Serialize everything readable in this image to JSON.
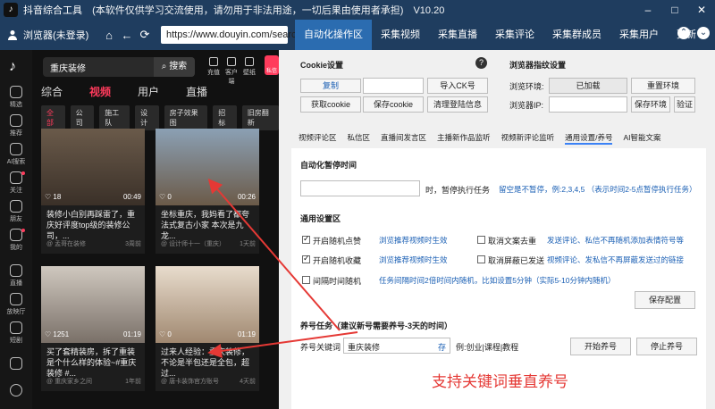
{
  "title_bar": {
    "app_title": "抖音综合工具",
    "notice": "(本软件仅供学习交流使用，请勿用于非法用途，一切后果由使用者承担)",
    "version": "V10.20"
  },
  "toolbar": {
    "browser_label": "浏览器(未登录)",
    "url": "https://www.douyin.com/search/",
    "nav_tabs": [
      "自动化操作区",
      "采集视频",
      "采集直播",
      "采集评论",
      "采集群成员",
      "采集用户",
      "更新"
    ]
  },
  "left": {
    "sidebar": [
      "精选",
      "推荐",
      "AI搜索",
      "关注",
      "朋友",
      "我的",
      "直播",
      "放映厅",
      "短剧"
    ],
    "search_query": "重庆装修",
    "search_button": "搜索",
    "top_icons": [
      "充值",
      "客户端",
      "壁纸",
      "私信"
    ],
    "tabs": [
      "综合",
      "视频",
      "用户",
      "直播"
    ],
    "filters": [
      "全部",
      "公司",
      "施工队",
      "设计",
      "房子效果图",
      "招标",
      "旧房翻新"
    ],
    "cards": [
      {
        "likes": "18",
        "duration": "00:49",
        "title": "装修小白别再踩雷了，重庆好评度top级的装修公司，...",
        "author": "孟哥在装修",
        "ago": "3周前"
      },
      {
        "likes": "0",
        "duration": "00:26",
        "title": "坐标重庆，我妈看了都夸法式复古小家 本次是九龙...",
        "author": "设计师十一（重庆）",
        "ago": "1天前"
      },
      {
        "likes": "1251",
        "duration": "01:19",
        "title": "买了套精装房，拆了重装是个什么样的体验~#重庆装修 #...",
        "author": "重庆家乡之间",
        "ago": "1年前"
      },
      {
        "likes": "0",
        "duration": "01:19",
        "title": "过来人经验：重庆装修，不论是半包还是全包，超过...",
        "author": "唐卡装饰官方账号",
        "ago": "4天前"
      }
    ]
  },
  "right": {
    "cookie_title": "Cookie设置",
    "cookie_copy": "复制",
    "cookie_import": "导入CK号",
    "cookie_get": "获取cookie",
    "cookie_save": "保存cookie",
    "cookie_clear": "清理登陆信息",
    "fingerprint_title": "浏览器指纹设置",
    "env_label": "浏览环境:",
    "env_value": "已加载",
    "env_reset": "重置环境",
    "ip_label": "浏览器IP:",
    "ip_save": "保存环境",
    "ip_verify": "验证",
    "sub_tabs": [
      "视频评论区",
      "私信区",
      "直播间发言区",
      "主播新作品监听",
      "视频新评论监听",
      "通用设置/养号",
      "AI智能文案"
    ],
    "pause_title": "自动化暂停时间",
    "pause_suffix": "时，暂停执行任务",
    "pause_hint": "留空是不暂停，例:2,3,4,5 （表示时间2-5点暂停执行任务）",
    "general_title": "通用设置区",
    "options": [
      {
        "label": "开启随机点赞",
        "checked": true,
        "desc": "浏览推荐视频时生效"
      },
      {
        "label": "开启随机收藏",
        "checked": true,
        "desc": "浏览推荐视频时生效"
      },
      {
        "label": "间隔时间随机",
        "checked": false,
        "desc": "任务间隔时间2倍时间内随机，比如设置5分钟（实际5-10分钟内随机）"
      }
    ],
    "options_right": [
      {
        "label": "取消文案去重",
        "checked": false,
        "desc": "发送评论、私信不再随机添加表情符号等"
      },
      {
        "label": "取消屏蔽已发送",
        "checked": false,
        "desc": "视频评论、发私信不再屏蔽发送过的链接"
      }
    ],
    "save_config": "保存配置",
    "nurture_title": "养号任务（建议新号需要养号-3天的时间）",
    "keyword_label": "养号关键词",
    "keyword_value": "重庆装修",
    "keyword_save": "存",
    "keyword_example": "例:创业|课程|教程",
    "start_nurture": "开始养号",
    "stop_nurture": "停止养号"
  },
  "annotation": "支持关键词垂直养号",
  "colors": {
    "title_bg": "#1f3d5f",
    "active_tab": "#2b6cb0",
    "douyin_red": "#ff3b5c",
    "annotation_red": "#e53935",
    "desc_blue": "#1a5fb4"
  }
}
